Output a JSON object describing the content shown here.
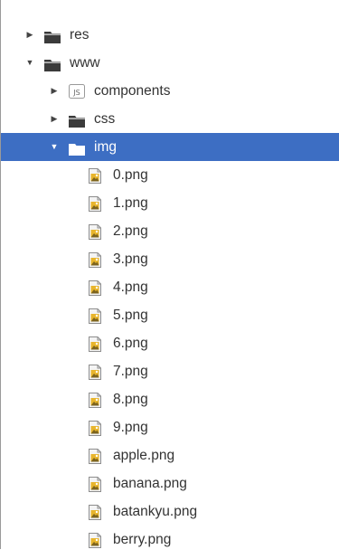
{
  "colors": {
    "selection": "#3d6ec3",
    "folder": "#3b3b3b",
    "image_file_icon": "#e8b52c"
  },
  "tree": [
    {
      "label": "res",
      "name": "tree-item-res",
      "depth": 0,
      "type": "folder",
      "expanded": false,
      "selected": false
    },
    {
      "label": "www",
      "name": "tree-item-www",
      "depth": 0,
      "type": "folder",
      "expanded": true,
      "selected": false
    },
    {
      "label": "components",
      "name": "tree-item-components",
      "depth": 1,
      "type": "js-folder",
      "expanded": false,
      "selected": false
    },
    {
      "label": "css",
      "name": "tree-item-css",
      "depth": 1,
      "type": "folder",
      "expanded": false,
      "selected": false
    },
    {
      "label": "img",
      "name": "tree-item-img",
      "depth": 1,
      "type": "folder",
      "expanded": true,
      "selected": true
    },
    {
      "label": "0.png",
      "name": "tree-item-0-png",
      "depth": 2,
      "type": "image",
      "selected": false
    },
    {
      "label": "1.png",
      "name": "tree-item-1-png",
      "depth": 2,
      "type": "image",
      "selected": false
    },
    {
      "label": "2.png",
      "name": "tree-item-2-png",
      "depth": 2,
      "type": "image",
      "selected": false
    },
    {
      "label": "3.png",
      "name": "tree-item-3-png",
      "depth": 2,
      "type": "image",
      "selected": false
    },
    {
      "label": "4.png",
      "name": "tree-item-4-png",
      "depth": 2,
      "type": "image",
      "selected": false
    },
    {
      "label": "5.png",
      "name": "tree-item-5-png",
      "depth": 2,
      "type": "image",
      "selected": false
    },
    {
      "label": "6.png",
      "name": "tree-item-6-png",
      "depth": 2,
      "type": "image",
      "selected": false
    },
    {
      "label": "7.png",
      "name": "tree-item-7-png",
      "depth": 2,
      "type": "image",
      "selected": false
    },
    {
      "label": "8.png",
      "name": "tree-item-8-png",
      "depth": 2,
      "type": "image",
      "selected": false
    },
    {
      "label": "9.png",
      "name": "tree-item-9-png",
      "depth": 2,
      "type": "image",
      "selected": false
    },
    {
      "label": "apple.png",
      "name": "tree-item-apple-png",
      "depth": 2,
      "type": "image",
      "selected": false
    },
    {
      "label": "banana.png",
      "name": "tree-item-banana-png",
      "depth": 2,
      "type": "image",
      "selected": false
    },
    {
      "label": "batankyu.png",
      "name": "tree-item-batankyu-png",
      "depth": 2,
      "type": "image",
      "selected": false
    },
    {
      "label": "berry.png",
      "name": "tree-item-berry-png",
      "depth": 2,
      "type": "image",
      "selected": false
    }
  ]
}
